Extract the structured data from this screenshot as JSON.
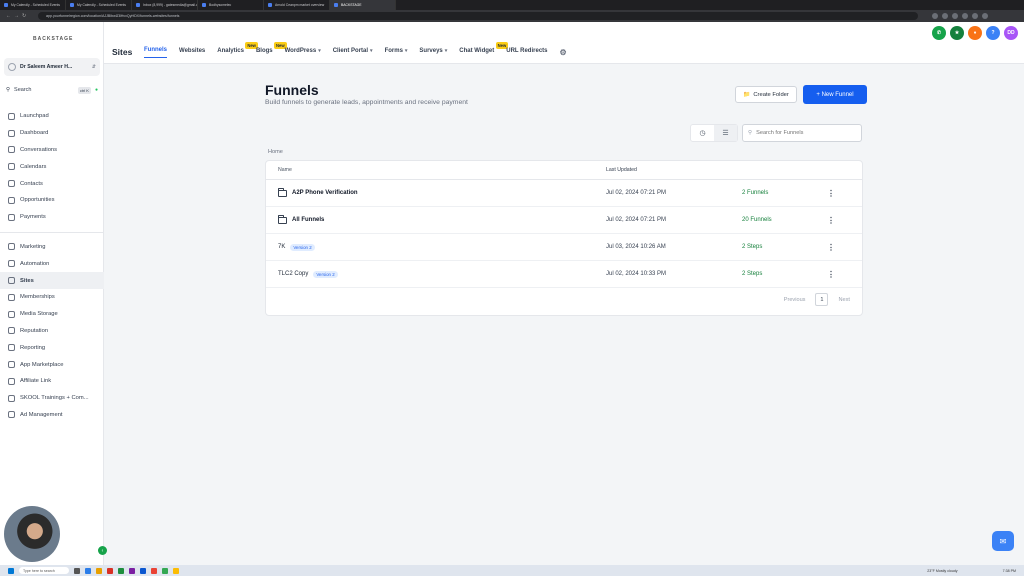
{
  "browser": {
    "tabs": [
      {
        "label": "My Calendly - Scheduled Events",
        "active": false
      },
      {
        "label": "My Calendly - Scheduled Events",
        "active": false
      },
      {
        "label": "Inbox (8,999) - gatesmedia@gmail.com",
        "active": false
      },
      {
        "label": "Bodhysomelec",
        "active": false
      },
      {
        "label": "Arnold Ceanpm market overview",
        "active": false
      },
      {
        "label": "BACKSTAGE",
        "active": true
      }
    ],
    "url": "app.yourfunnelregion.com/location/AJJBlbwlZ8HvxQyHDX/funnels-websites/funnels"
  },
  "sidebar": {
    "brand": "BACKSTAGE",
    "account_name": "Dr Saleem Ameer H...",
    "search_label": "Search",
    "search_shortcut": "ctrl K",
    "items": [
      {
        "label": "Launchpad",
        "active": false
      },
      {
        "label": "Dashboard",
        "active": false
      },
      {
        "label": "Conversations",
        "active": false
      },
      {
        "label": "Calendars",
        "active": false
      },
      {
        "label": "Contacts",
        "active": false
      },
      {
        "label": "Opportunities",
        "active": false
      },
      {
        "label": "Payments",
        "active": false
      }
    ],
    "items2": [
      {
        "label": "Marketing",
        "active": false
      },
      {
        "label": "Automation",
        "active": false
      },
      {
        "label": "Sites",
        "active": true
      },
      {
        "label": "Memberships",
        "active": false
      },
      {
        "label": "Media Storage",
        "active": false
      },
      {
        "label": "Reputation",
        "active": false
      },
      {
        "label": "Reporting",
        "active": false
      },
      {
        "label": "App Marketplace",
        "active": false
      },
      {
        "label": "Affiliate Link",
        "active": false
      },
      {
        "label": "SKOOL Trainings + Com...",
        "active": false
      },
      {
        "label": "Ad Management",
        "active": false
      }
    ]
  },
  "header": {
    "section_title": "Sites",
    "tabs": [
      {
        "label": "Funnels",
        "active": true,
        "badge": "",
        "dropdown": false
      },
      {
        "label": "Websites",
        "active": false,
        "badge": "",
        "dropdown": false
      },
      {
        "label": "Analytics",
        "active": false,
        "badge": "New",
        "dropdown": false
      },
      {
        "label": "Blogs",
        "active": false,
        "badge": "New",
        "dropdown": false
      },
      {
        "label": "WordPress",
        "active": false,
        "badge": "",
        "dropdown": true
      },
      {
        "label": "Client Portal",
        "active": false,
        "badge": "",
        "dropdown": true
      },
      {
        "label": "Forms",
        "active": false,
        "badge": "",
        "dropdown": true
      },
      {
        "label": "Surveys",
        "active": false,
        "badge": "",
        "dropdown": true
      },
      {
        "label": "Chat Widget",
        "active": false,
        "badge": "New",
        "dropdown": false
      },
      {
        "label": "URL Redirects",
        "active": false,
        "badge": "",
        "dropdown": false
      }
    ],
    "avatar_initials": "DD",
    "help_label": "?"
  },
  "main": {
    "title": "Funnels",
    "subtitle": "Build funnels to generate leads, appointments and receive payment",
    "create_folder_label": "Create Folder",
    "new_funnel_label": "+ New Funnel",
    "search_placeholder": "Search for Funnels",
    "breadcrumb": "Home",
    "columns": {
      "name": "Name",
      "last_updated": "Last Updated"
    },
    "rows": [
      {
        "name": "A2P Phone Verification",
        "type": "folder",
        "version": "",
        "updated": "Jul 02, 2024 07:21 PM",
        "count": "2 Funnels"
      },
      {
        "name": "All Funnels",
        "type": "folder",
        "version": "",
        "updated": "Jul 02, 2024 07:21 PM",
        "count": "20 Funnels"
      },
      {
        "name": "7K",
        "type": "funnel",
        "version": "Version 2",
        "updated": "Jul 03, 2024 10:26 AM",
        "count": "2 Steps"
      },
      {
        "name": "TLC2 Copy",
        "type": "funnel",
        "version": "Version 2",
        "updated": "Jul 02, 2024 10:33 PM",
        "count": "2 Steps"
      }
    ],
    "pagination": {
      "previous": "Previous",
      "page": "1",
      "next": "Next"
    }
  },
  "taskbar": {
    "search_placeholder": "Type here to search",
    "weather": "23°F Mostly cloudy",
    "time": "7:38 PM"
  },
  "colors": {
    "primary": "#155eef",
    "active_tab": "#2563eb",
    "count_green": "#16803c",
    "new_badge": "#facc15"
  }
}
